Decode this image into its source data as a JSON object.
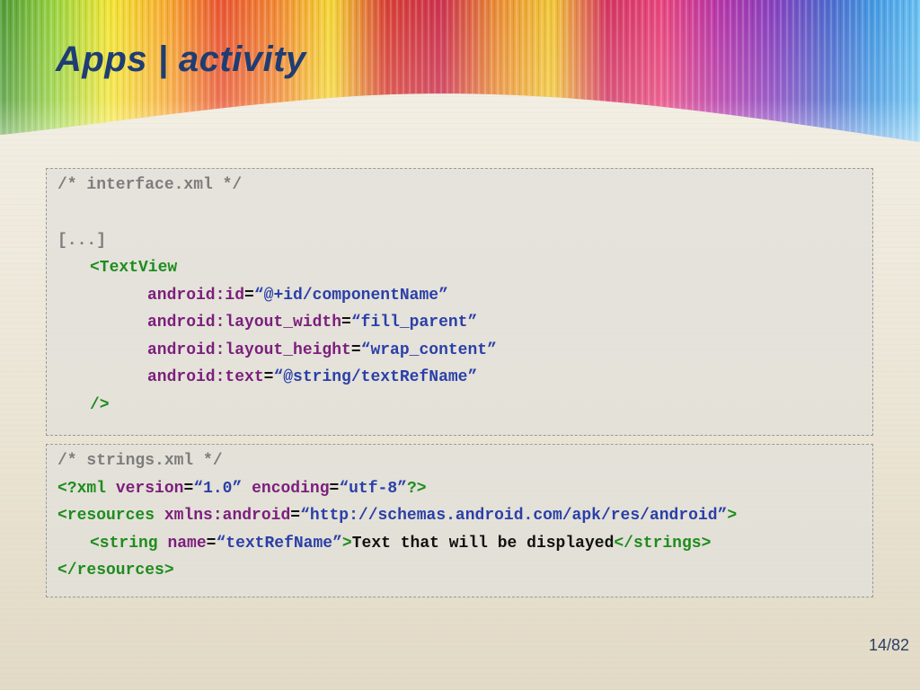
{
  "slide": {
    "title": "Apps | activity",
    "page_number": "14/82"
  },
  "colors": {
    "title": "#1f3d72",
    "comment": "#7d7d7d",
    "tag": "#1e8c1e",
    "attribute": "#7c1e7c",
    "string": "#2b3fa8",
    "text": "#111111"
  },
  "code_interface": {
    "comment": "/* interface.xml */",
    "ellipsis": "[...]",
    "open_tag": "<TextView",
    "lines": [
      {
        "attr": "android:id",
        "eq": "=",
        "value": "“@+id/componentName”"
      },
      {
        "attr": "android:layout_width",
        "eq": "=",
        "value": "“fill_parent”"
      },
      {
        "attr": "android:layout_height",
        "eq": "=",
        "value": "“wrap_content”"
      },
      {
        "attr": "android:text",
        "eq": "=",
        "value": "“@string/textRefName”"
      }
    ],
    "close_tag": "/>"
  },
  "code_strings": {
    "comment": "/* strings.xml */",
    "xml_decl": {
      "open": "<?xml",
      "attr1": "version",
      "eq": "=",
      "val1": "“1.0”",
      "attr2": "encoding",
      "val2": "“utf-8”",
      "close": "?>"
    },
    "resources_open": {
      "tag": "<resources",
      "attr": "xmlns:android",
      "eq": "=",
      "value": "“http://schemas.android.com/apk/res/android”",
      "close": ">"
    },
    "string_line": {
      "tag": "<string",
      "attr": "name",
      "eq": "=",
      "value": "“textRefName”",
      "close": ">",
      "text": "Text that will be displayed",
      "end_tag": "</strings>"
    },
    "resources_close": "</resources>"
  }
}
